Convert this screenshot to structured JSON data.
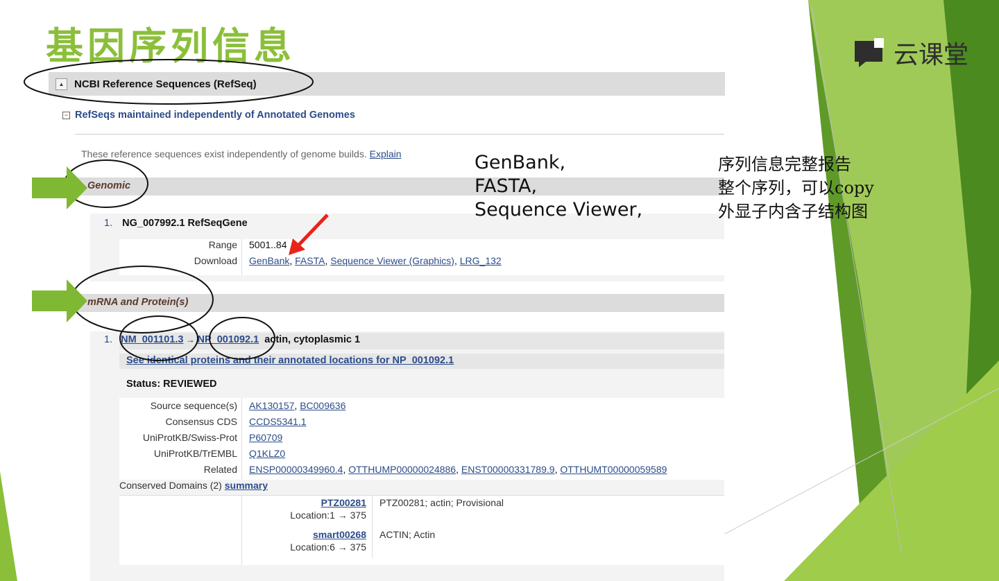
{
  "slide": {
    "title": "基因序列信息",
    "brand": "云课堂"
  },
  "ncbi": {
    "section_title": "NCBI Reference Sequences (RefSeq)",
    "subsection_title": "RefSeqs maintained independently of Annotated Genomes",
    "independent_note": "These reference sequences exist independently of genome builds.",
    "explain_link": "Explain",
    "genomic": {
      "label": "Genomic",
      "item_number": "1.",
      "item_title": "NG_007992.1 RefSeqGene",
      "range_label": "Range",
      "range_value": "5001..84",
      "download_label": "Download",
      "download_links": [
        "GenBank",
        "FASTA",
        "Sequence Viewer (Graphics)",
        "LRG_132"
      ]
    },
    "mrna": {
      "label": "mRNA and Protein(s)",
      "item_number": "1.",
      "mrna_link": "NM_001101.3",
      "arrow": "→",
      "protein_link": "NP_001092.1",
      "description": "actin, cytoplasmic 1",
      "identical_link": "See identical proteins and their annotated locations for NP_001092.1",
      "status": "Status: REVIEWED",
      "fields": [
        {
          "label": "Source sequence(s)",
          "links": [
            "AK130157",
            "BC009636"
          ]
        },
        {
          "label": "Consensus CDS",
          "links": [
            "CCDS5341.1"
          ]
        },
        {
          "label": "UniProtKB/Swiss-Prot",
          "links": [
            "P60709"
          ]
        },
        {
          "label": "UniProtKB/TrEMBL",
          "links": [
            "Q1KLZ0"
          ]
        },
        {
          "label": "Related",
          "links": [
            "ENSP00000349960.4",
            "OTTHUMP00000024886",
            "ENST00000331789.9",
            "OTTHUMT00000059589"
          ]
        }
      ],
      "conserved_label": "Conserved Domains (2)",
      "conserved_link": "summary",
      "domains": [
        {
          "id": "PTZ00281",
          "location": "Location:1 → 375",
          "desc": "PTZ00281; actin; Provisional"
        },
        {
          "id": "smart00268",
          "location": "Location:6 → 375",
          "desc": "ACTIN; Actin"
        }
      ]
    }
  },
  "annotations": {
    "formats_line1": "GenBank,",
    "formats_line2": "FASTA,",
    "formats_line3": "Sequence Viewer,",
    "note_line1": "序列信息完整报告",
    "note_line2": "整个序列，可以copy",
    "note_line3": "外显子内含子结构图"
  },
  "colors": {
    "title_green": "#8bbf3a",
    "link_blue": "#2b4c8a",
    "arrow_green": "#7fb832",
    "annotation_red": "#e8231a"
  }
}
